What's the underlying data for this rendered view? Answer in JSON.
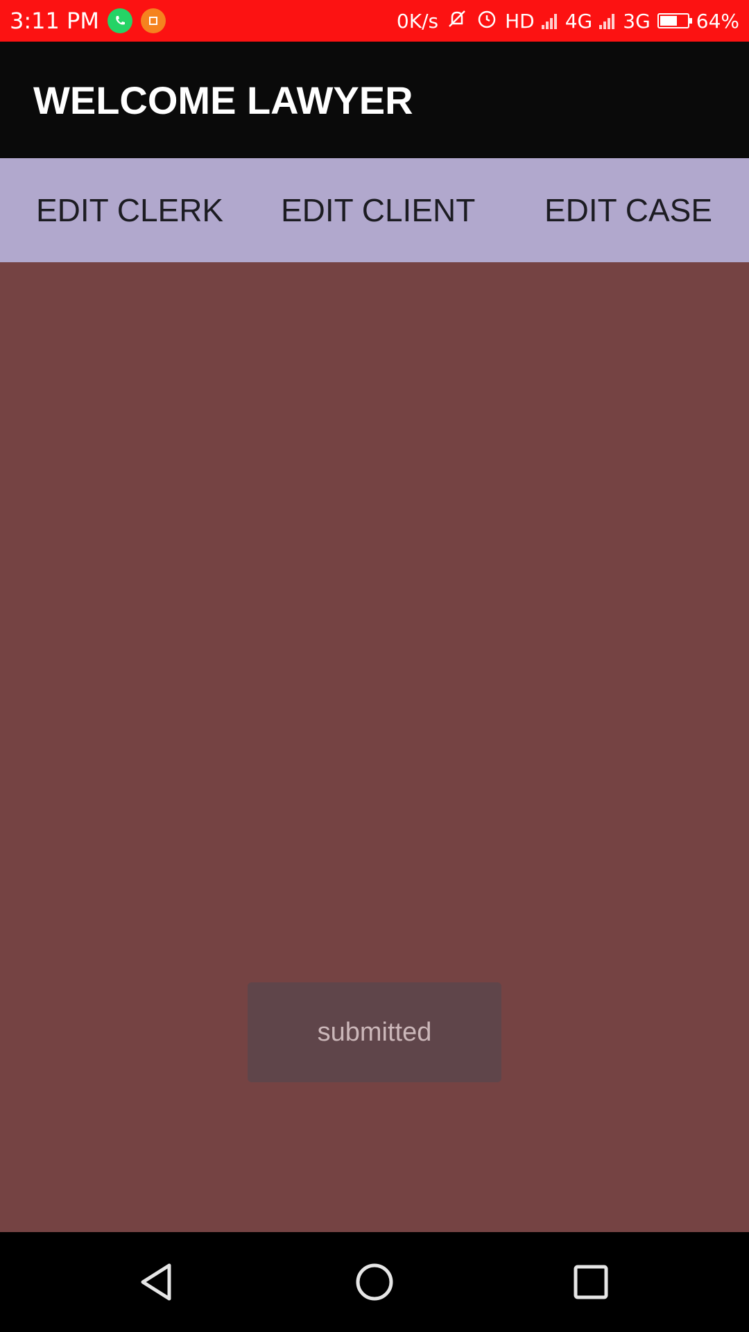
{
  "status_bar": {
    "time": "3:11 PM",
    "net_speed": "0K/s",
    "hd_label": "HD",
    "network_1": "4G",
    "network_2": "3G",
    "battery_percent": "64%",
    "battery_level": 0.64,
    "icons": [
      "whatsapp-icon",
      "orange-app-icon",
      "mute-icon",
      "alarm-icon",
      "signal-icon",
      "battery-icon"
    ]
  },
  "app_bar": {
    "title": "WELCOME LAWYER"
  },
  "menu": {
    "edit_clerk": "EDIT CLERK",
    "edit_client": "EDIT CLIENT",
    "edit_case": "EDIT CASE"
  },
  "toast": {
    "message": "submitted"
  },
  "nav": {
    "icons": [
      "back-icon",
      "home-icon",
      "recent-apps-icon"
    ]
  },
  "colors": {
    "status_bar": "#fc1212",
    "app_bar": "#0a0a0a",
    "menu_bar": "#b1a8cd",
    "content_bg": "#754343",
    "toast_bg": "#5f454a"
  }
}
